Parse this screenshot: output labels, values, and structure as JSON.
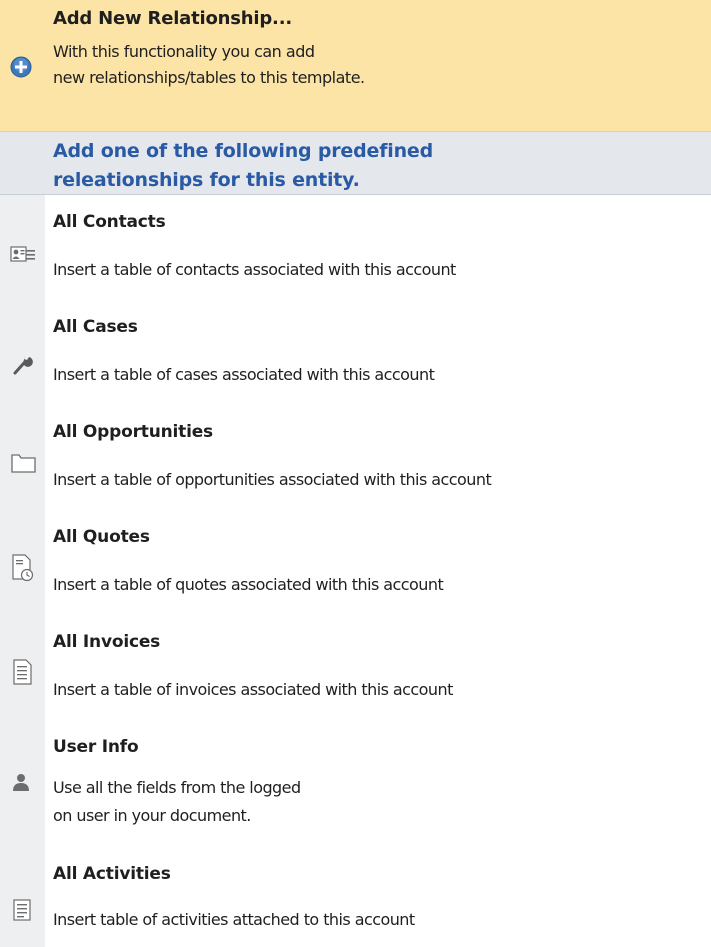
{
  "add_new": {
    "title": "Add New Relationship...",
    "desc_line1": "With this functionality you can add",
    "desc_line2": "new relationships/tables to this template.",
    "icon": "plus-circle-icon",
    "background": "#fce4a6"
  },
  "section_header": {
    "line1": "Add one of the following predefined",
    "line2": "releationships for this entity.",
    "color": "#2a5aa3"
  },
  "items": [
    {
      "title": "All Contacts",
      "desc": "Insert a table of contacts associated with this account",
      "icon": "contact-card-icon"
    },
    {
      "title": "All Cases",
      "desc": "Insert a table of cases associated with this account",
      "icon": "wrench-icon"
    },
    {
      "title": "All Opportunities",
      "desc": "Insert a table of opportunities associated with this account",
      "icon": "folder-icon"
    },
    {
      "title": "All Quotes",
      "desc": "Insert a table of quotes associated with this account",
      "icon": "document-clock-icon"
    },
    {
      "title": "All Invoices",
      "desc": "Insert a table of invoices associated with this account",
      "icon": "document-icon"
    },
    {
      "title": "User Info",
      "desc_line1": "Use all the fields from the logged",
      "desc_line2": "on user in your document.",
      "icon": "user-icon"
    },
    {
      "title": "All Activities",
      "desc": "Insert table of activities attached to this account",
      "icon": "notes-icon"
    }
  ]
}
